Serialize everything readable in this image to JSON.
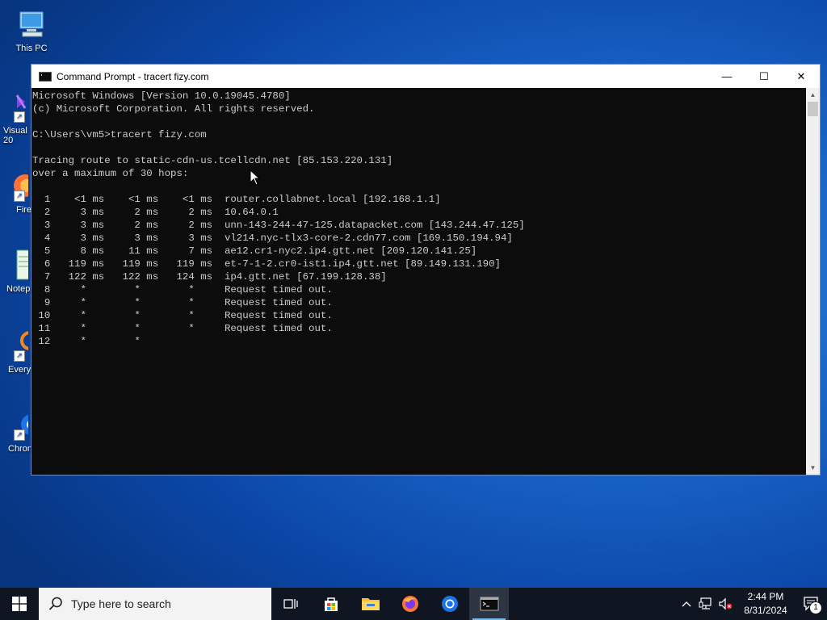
{
  "desktop": {
    "icons": [
      {
        "label": "This PC"
      },
      {
        "label": "Visual\n20"
      },
      {
        "label": "Fire"
      },
      {
        "label": "Notep"
      },
      {
        "label": "Every"
      },
      {
        "label": "Chron"
      }
    ]
  },
  "window": {
    "title": "Command Prompt - tracert  fizy.com",
    "buttons": {
      "minimize": "—",
      "maximize": "☐",
      "close": "✕"
    },
    "console_lines": [
      "Microsoft Windows [Version 10.0.19045.4780]",
      "(c) Microsoft Corporation. All rights reserved.",
      "",
      "C:\\Users\\vm5>tracert fizy.com",
      "",
      "Tracing route to static-cdn-us.tcellcdn.net [85.153.220.131]",
      "over a maximum of 30 hops:",
      "",
      "  1    <1 ms    <1 ms    <1 ms  router.collabnet.local [192.168.1.1]",
      "  2     3 ms     2 ms     2 ms  10.64.0.1",
      "  3     3 ms     2 ms     2 ms  unn-143-244-47-125.datapacket.com [143.244.47.125]",
      "  4     3 ms     3 ms     3 ms  vl214.nyc-tlx3-core-2.cdn77.com [169.150.194.94]",
      "  5     8 ms    11 ms     7 ms  ae12.cr1-nyc2.ip4.gtt.net [209.120.141.25]",
      "  6   119 ms   119 ms   119 ms  et-7-1-2.cr0-ist1.ip4.gtt.net [89.149.131.190]",
      "  7   122 ms   122 ms   124 ms  ip4.gtt.net [67.199.128.38]",
      "  8     *        *        *     Request timed out.",
      "  9     *        *        *     Request timed out.",
      " 10     *        *        *     Request timed out.",
      " 11     *        *        *     Request timed out.",
      " 12     *        *"
    ]
  },
  "taskbar": {
    "search_placeholder": "Type here to search",
    "clock_time": "2:44 PM",
    "clock_date": "8/31/2024",
    "notification_count": "1"
  }
}
